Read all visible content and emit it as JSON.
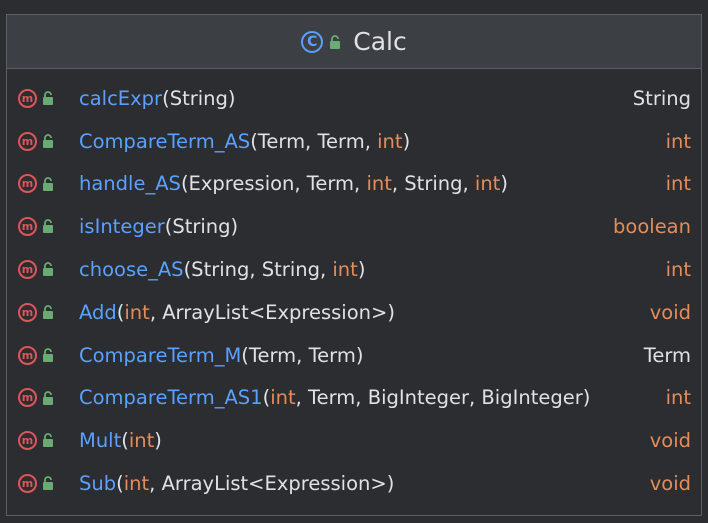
{
  "class": {
    "badge": "C",
    "name": "Calc"
  },
  "method_badge": "m",
  "methods": [
    {
      "name": "calcExpr",
      "params": [
        {
          "t": "(",
          "k": false
        },
        {
          "t": "String",
          "k": false
        },
        {
          "t": ")",
          "k": false
        }
      ],
      "ret": "String",
      "ret_kw": false
    },
    {
      "name": "CompareTerm_AS",
      "params": [
        {
          "t": "(Term, Term, ",
          "k": false
        },
        {
          "t": "int",
          "k": true
        },
        {
          "t": ")",
          "k": false
        }
      ],
      "ret": "int",
      "ret_kw": true
    },
    {
      "name": "handle_AS",
      "params": [
        {
          "t": "(Expression, Term, ",
          "k": false
        },
        {
          "t": "int",
          "k": true
        },
        {
          "t": ", String, ",
          "k": false
        },
        {
          "t": "int",
          "k": true
        },
        {
          "t": ")",
          "k": false
        }
      ],
      "ret": "int",
      "ret_kw": true
    },
    {
      "name": "isInteger",
      "params": [
        {
          "t": "(String)",
          "k": false
        }
      ],
      "ret": "boolean",
      "ret_kw": true
    },
    {
      "name": "choose_AS",
      "params": [
        {
          "t": "(String, String, ",
          "k": false
        },
        {
          "t": "int",
          "k": true
        },
        {
          "t": ")",
          "k": false
        }
      ],
      "ret": "int",
      "ret_kw": true
    },
    {
      "name": "Add",
      "params": [
        {
          "t": "(",
          "k": false
        },
        {
          "t": "int",
          "k": true
        },
        {
          "t": ", ArrayList<Expression>)",
          "k": false
        }
      ],
      "ret": "void",
      "ret_kw": true
    },
    {
      "name": "CompareTerm_M",
      "params": [
        {
          "t": "(Term, Term)",
          "k": false
        }
      ],
      "ret": "Term",
      "ret_kw": false
    },
    {
      "name": "CompareTerm_AS1",
      "params": [
        {
          "t": "(",
          "k": false
        },
        {
          "t": "int",
          "k": true
        },
        {
          "t": ", Term, BigInteger, BigInteger)",
          "k": false
        }
      ],
      "ret": "int",
      "ret_kw": true
    },
    {
      "name": "Mult",
      "params": [
        {
          "t": "(",
          "k": false
        },
        {
          "t": "int",
          "k": true
        },
        {
          "t": ")",
          "k": false
        }
      ],
      "ret": "void",
      "ret_kw": true
    },
    {
      "name": "Sub",
      "params": [
        {
          "t": "(",
          "k": false
        },
        {
          "t": "int",
          "k": true
        },
        {
          "t": ", ArrayList<Expression>)",
          "k": false
        }
      ],
      "ret": "void",
      "ret_kw": true
    }
  ],
  "colors": {
    "background": "#2b2d30",
    "header": "#3c3f43",
    "border": "#5c5f66",
    "method_name": "#5aa0ff",
    "keyword": "#e48c5a",
    "text": "#dfe1e5",
    "method_badge": "#e0555a",
    "class_badge": "#5aa0ff",
    "lock": "#6aab73"
  },
  "icons": {
    "class": "class-icon",
    "method": "method-icon",
    "visibility": "public-lock-icon"
  }
}
